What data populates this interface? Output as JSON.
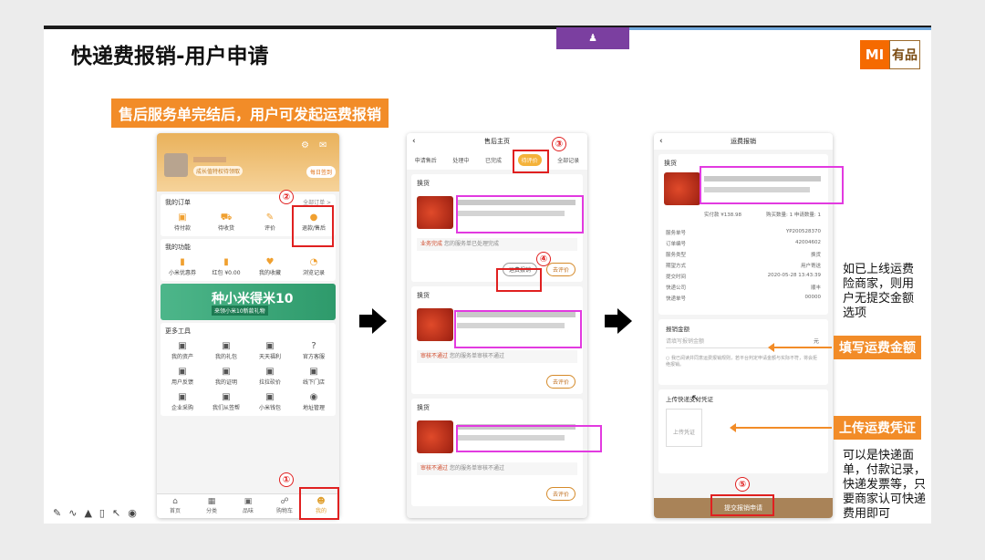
{
  "slide": {
    "title": "快递费报销-用户申请",
    "subtitle": "售后服务单完结后，用户可发起运费报销",
    "top_tab_icon": "person-icon",
    "logo": {
      "mi": "MI",
      "youpin": "有品"
    }
  },
  "phone1": {
    "vip_badge": "成长值特权待领取",
    "signin": "每日签到",
    "my_orders_title": "我的订单",
    "all_orders": "全部订单 >",
    "order_items": [
      "待付款",
      "待收货",
      "评价",
      "退款/售后"
    ],
    "functions_title": "我的功能",
    "function_items": [
      "小米优惠券",
      "红包 ¥0.00",
      "我的收藏",
      "浏览记录"
    ],
    "banner_title": "种小米得米10",
    "banner_sub": "来领小米10新款礼物",
    "tools_title": "更多工具",
    "tool_items": [
      "我的资产",
      "我的礼包",
      "天天福利",
      "官方客服",
      "用户反馈",
      "我的证明",
      "拉拉砍价",
      "线下门店",
      "企业采购",
      "我们从签帮",
      "小米钱包",
      "地址管理"
    ],
    "tabbar": [
      "首页",
      "分类",
      "品味",
      "购物车",
      "我的"
    ]
  },
  "phone2": {
    "nav_title": "售后主页",
    "tabs": [
      "申请售后",
      "处理中",
      "已完成",
      "待评价",
      "全部记录"
    ],
    "order1": {
      "tag": "换货",
      "status_prefix": "业务完成",
      "status": "您的服务单已处理完成",
      "btn_primary": "运费报销",
      "btn_secondary": "去评价"
    },
    "order2": {
      "tag": "换货",
      "status_prefix": "审核不通过",
      "status": "您的服务单审核不通过",
      "btn_secondary": "去评价"
    },
    "order3": {
      "tag": "换货",
      "status_prefix": "审核不通过",
      "status": "您的服务单审核不通过",
      "btn_secondary": "去评价"
    }
  },
  "phone3": {
    "nav_title": "运费报销",
    "order_tag": "换货",
    "price_line": "实付款 ¥138.98",
    "qty_line": "购买数量: 1  申请数量: 1",
    "details": [
      {
        "k": "服务单号",
        "v": "YP200528370"
      },
      {
        "k": "订单编号",
        "v": "42004602"
      },
      {
        "k": "服务类型",
        "v": "换货"
      },
      {
        "k": "期望方式",
        "v": "用户寄送"
      },
      {
        "k": "提交时间",
        "v": "2020-05-28 13:43:39"
      },
      {
        "k": "快递公司",
        "v": "顺丰"
      },
      {
        "k": "快递单号",
        "v": "00000"
      }
    ],
    "amount_label": "报销金额",
    "amount_placeholder": "请填写报销金额",
    "amount_unit": "元",
    "agreement": "我已阅读并同意运费报销规则，若平台判定申请金额与实际不符，将会拒绝报销。",
    "upload_label": "上传快递支付凭证",
    "upload_btn": "上传凭证",
    "submit": "提交报销申请"
  },
  "annotations": {
    "nums": [
      "①",
      "②",
      "③",
      "④",
      "⑤"
    ],
    "note_top": "如已上线运费险商家，则用户无提交金额选项",
    "label_amount": "填写运费金额",
    "label_upload": "上传运费凭证",
    "note_bottom": "可以是快递面单，付款记录，快递发票等，只要商家认可快递费用即可"
  }
}
